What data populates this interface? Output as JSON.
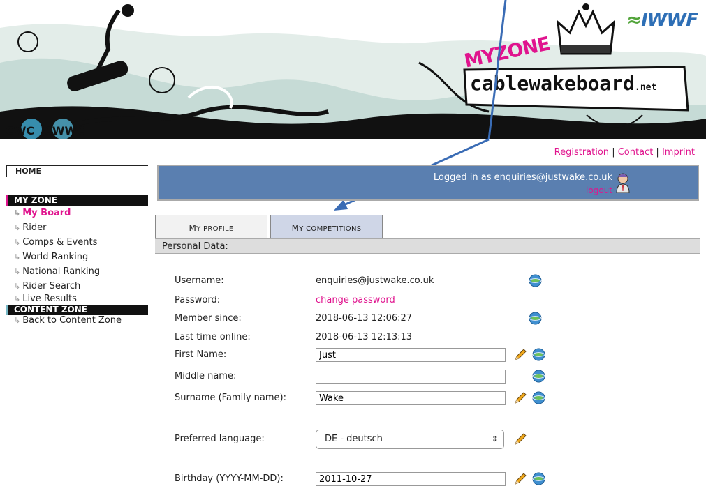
{
  "brand": {
    "iwwf": "IWWF",
    "myzone": "MYZONE",
    "site": "cablewakeboard",
    "site_suffix": ".net"
  },
  "logos": {
    "cwc": "CWC",
    "cwwc": "CWWC"
  },
  "top_links": {
    "registration": "Registration",
    "sep1": " | ",
    "contact": "Contact",
    "sep2": " | ",
    "imprint": "Imprint"
  },
  "sidebar": {
    "home": "HOME",
    "my_zone": "MY ZONE",
    "items": [
      {
        "label": "My Board"
      },
      {
        "label": "Rider"
      },
      {
        "label": "Comps & Events"
      },
      {
        "label": "World Ranking"
      },
      {
        "label": "National Ranking"
      },
      {
        "label": "Rider Search"
      },
      {
        "label": "Live Results"
      }
    ],
    "content_zone": "CONTENT ZONE",
    "back": "Back to Content Zone",
    "arrow": "↳"
  },
  "login": {
    "text": "Logged in as enquiries@justwake.co.uk",
    "logout": "logout"
  },
  "tabs": {
    "profile_first": "M",
    "profile_rest": "Y PROFILE",
    "competitions_first": "M",
    "competitions_rest": "Y COMPETITIONS"
  },
  "section_title": "Personal Data:",
  "form": {
    "username_label": "Username:",
    "username_value": "enquiries@justwake.co.uk",
    "password_label": "Password:",
    "password_link": "change password",
    "member_label": "Member since:",
    "member_value": "2018-06-13 12:06:27",
    "last_online_label": "Last time online:",
    "last_online_value": "2018-06-13 12:13:13",
    "first_name_label": "First Name:",
    "first_name_value": "Just",
    "middle_name_label": "Middle name:",
    "middle_name_value": "",
    "surname_label": "Surname (Family name):",
    "surname_value": "Wake",
    "language_label": "Preferred language:",
    "language_value": "DE - deutsch",
    "birthday_label": "Birthday (YYYY-MM-DD):",
    "birthday_value": "2011-10-27"
  },
  "colors": {
    "accent": "#e0148e",
    "login_bar": "#5a7fb0",
    "tab_active": "#cfd6e7",
    "arrow": "#3a6cb5"
  }
}
